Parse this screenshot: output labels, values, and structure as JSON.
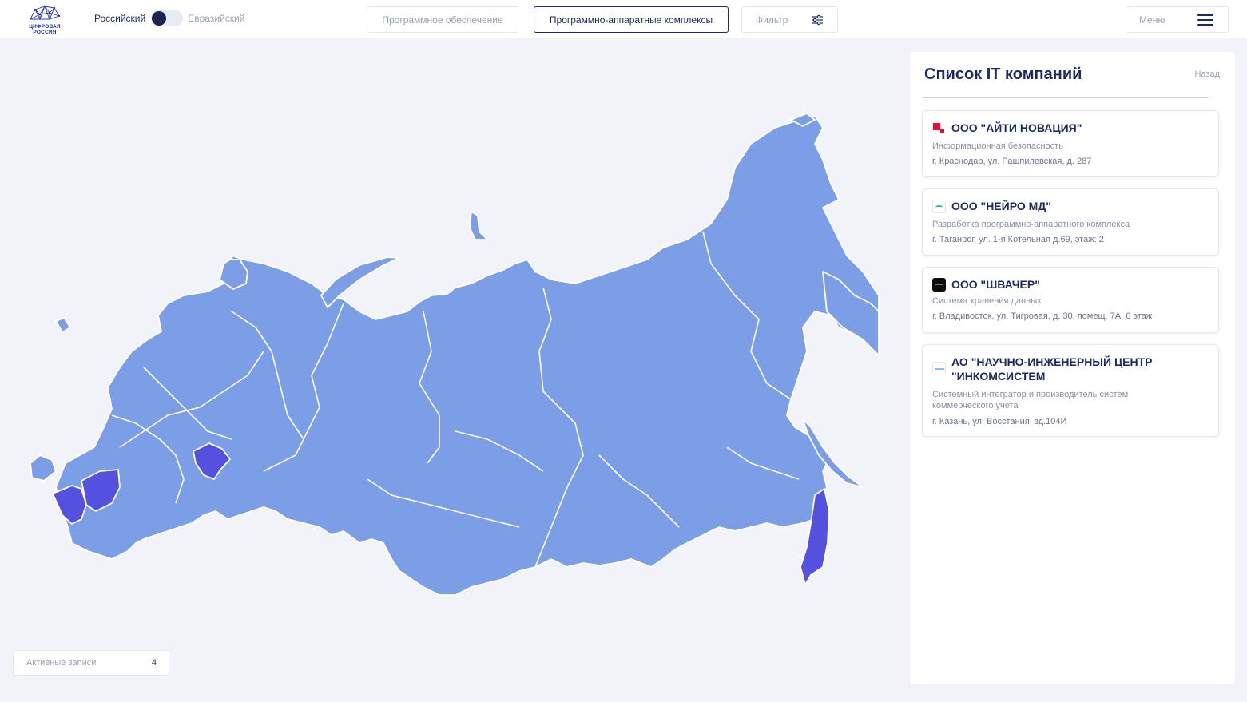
{
  "header": {
    "logo_text_line1": "ЦИФРОВАЯ",
    "logo_text_line2": "РОССИЯ",
    "toggle_left": "Российский",
    "toggle_right": "Евразийский",
    "nav_software": "Программное обеспечение",
    "nav_hardware": "Программно-аппаратные комплексы",
    "filter_label": "Фильтр",
    "menu_label": "Меню"
  },
  "map": {
    "base_color": "#7b9ee6",
    "highlight_color": "#5450e0",
    "border_color": "#ffffff",
    "highlighted_regions": [
      "Краснодарский край",
      "Ростовская область",
      "Республика Татарстан",
      "Приморский край"
    ]
  },
  "active_records": {
    "label": "Активные записи",
    "count": "4"
  },
  "panel": {
    "title": "Список IT компаний",
    "back_label": "Назад",
    "companies": [
      {
        "name": "ООО \"АЙТИ НОВАЦИЯ\"",
        "category": "Информационная безопасность",
        "address": "г. Краснодар, ул. Рашпилевская, д. 287"
      },
      {
        "name": "ООО \"НЕЙРО МД\"",
        "category": "Разработка программно-аппаратного комплекса",
        "address": "г. Таганрог, ул. 1-я Котельная д.69, этаж: 2"
      },
      {
        "name": "ООО \"ШВАЧЕР\"",
        "category": "Система хранения данных",
        "address": "г. Владивосток, ул. Тигровая, д. 30, помещ. 7А, 6 этаж"
      },
      {
        "name": "АО \"НАУЧНО-ИНЖЕНЕРНЫЙ ЦЕНТР \"ИНКОМСИСТЕМ",
        "category": "Системный интегратор и производитель систем коммерческого учета",
        "address": "г. Казань, ул. Восстания, зд.104И"
      }
    ]
  }
}
